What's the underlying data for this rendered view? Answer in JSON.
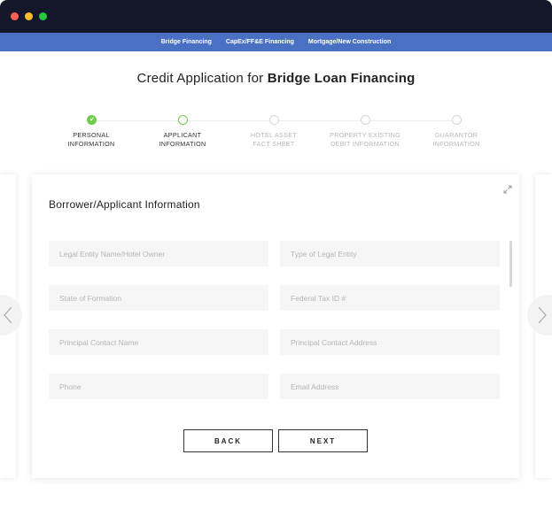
{
  "nav": {
    "links": [
      "Bridge Financing",
      "CapEx/FF&E Financing",
      "Mortgage/New Construction"
    ]
  },
  "header": {
    "title_prefix": "Credit Application for ",
    "title_emphasis": "Bridge Loan Financing"
  },
  "steps": [
    {
      "line1": "PERSONAL",
      "line2": "INFORMATION",
      "state": "complete"
    },
    {
      "line1": "APPLICANT",
      "line2": "INFORMATION",
      "state": "active"
    },
    {
      "line1": "HOTEL ASSET",
      "line2": "FACT SHEET",
      "state": "pending"
    },
    {
      "line1": "PROPERTY EXISTING",
      "line2": "DEBIT INFORMATION",
      "state": "pending"
    },
    {
      "line1": "GUARANTOR",
      "line2": "INFORMATION",
      "state": "pending"
    }
  ],
  "form": {
    "title": "Borrower/Applicant Information",
    "fields": {
      "legal_entity": {
        "placeholder": "Legal Entity Name/Hotel Owner",
        "value": ""
      },
      "entity_type": {
        "placeholder": "Type of Legal Entity",
        "value": ""
      },
      "state_formation": {
        "placeholder": "State of Formation",
        "value": ""
      },
      "tax_id": {
        "placeholder": "Federal Tax ID #",
        "value": ""
      },
      "contact_name": {
        "placeholder": "Principal Contact Name",
        "value": ""
      },
      "contact_address": {
        "placeholder": "Principal Contact Address",
        "value": ""
      },
      "phone": {
        "placeholder": "Phone",
        "value": ""
      },
      "email": {
        "placeholder": "Email Address",
        "value": ""
      }
    },
    "back_label": "BACK",
    "next_label": "NEXT"
  },
  "colors": {
    "nav_bar": "#4a70c4",
    "titlebar": "#14172a",
    "step_complete": "#6fcc4a"
  },
  "icons": [
    "check-icon",
    "expand-icon",
    "chevron-left-icon",
    "chevron-right-icon"
  ]
}
